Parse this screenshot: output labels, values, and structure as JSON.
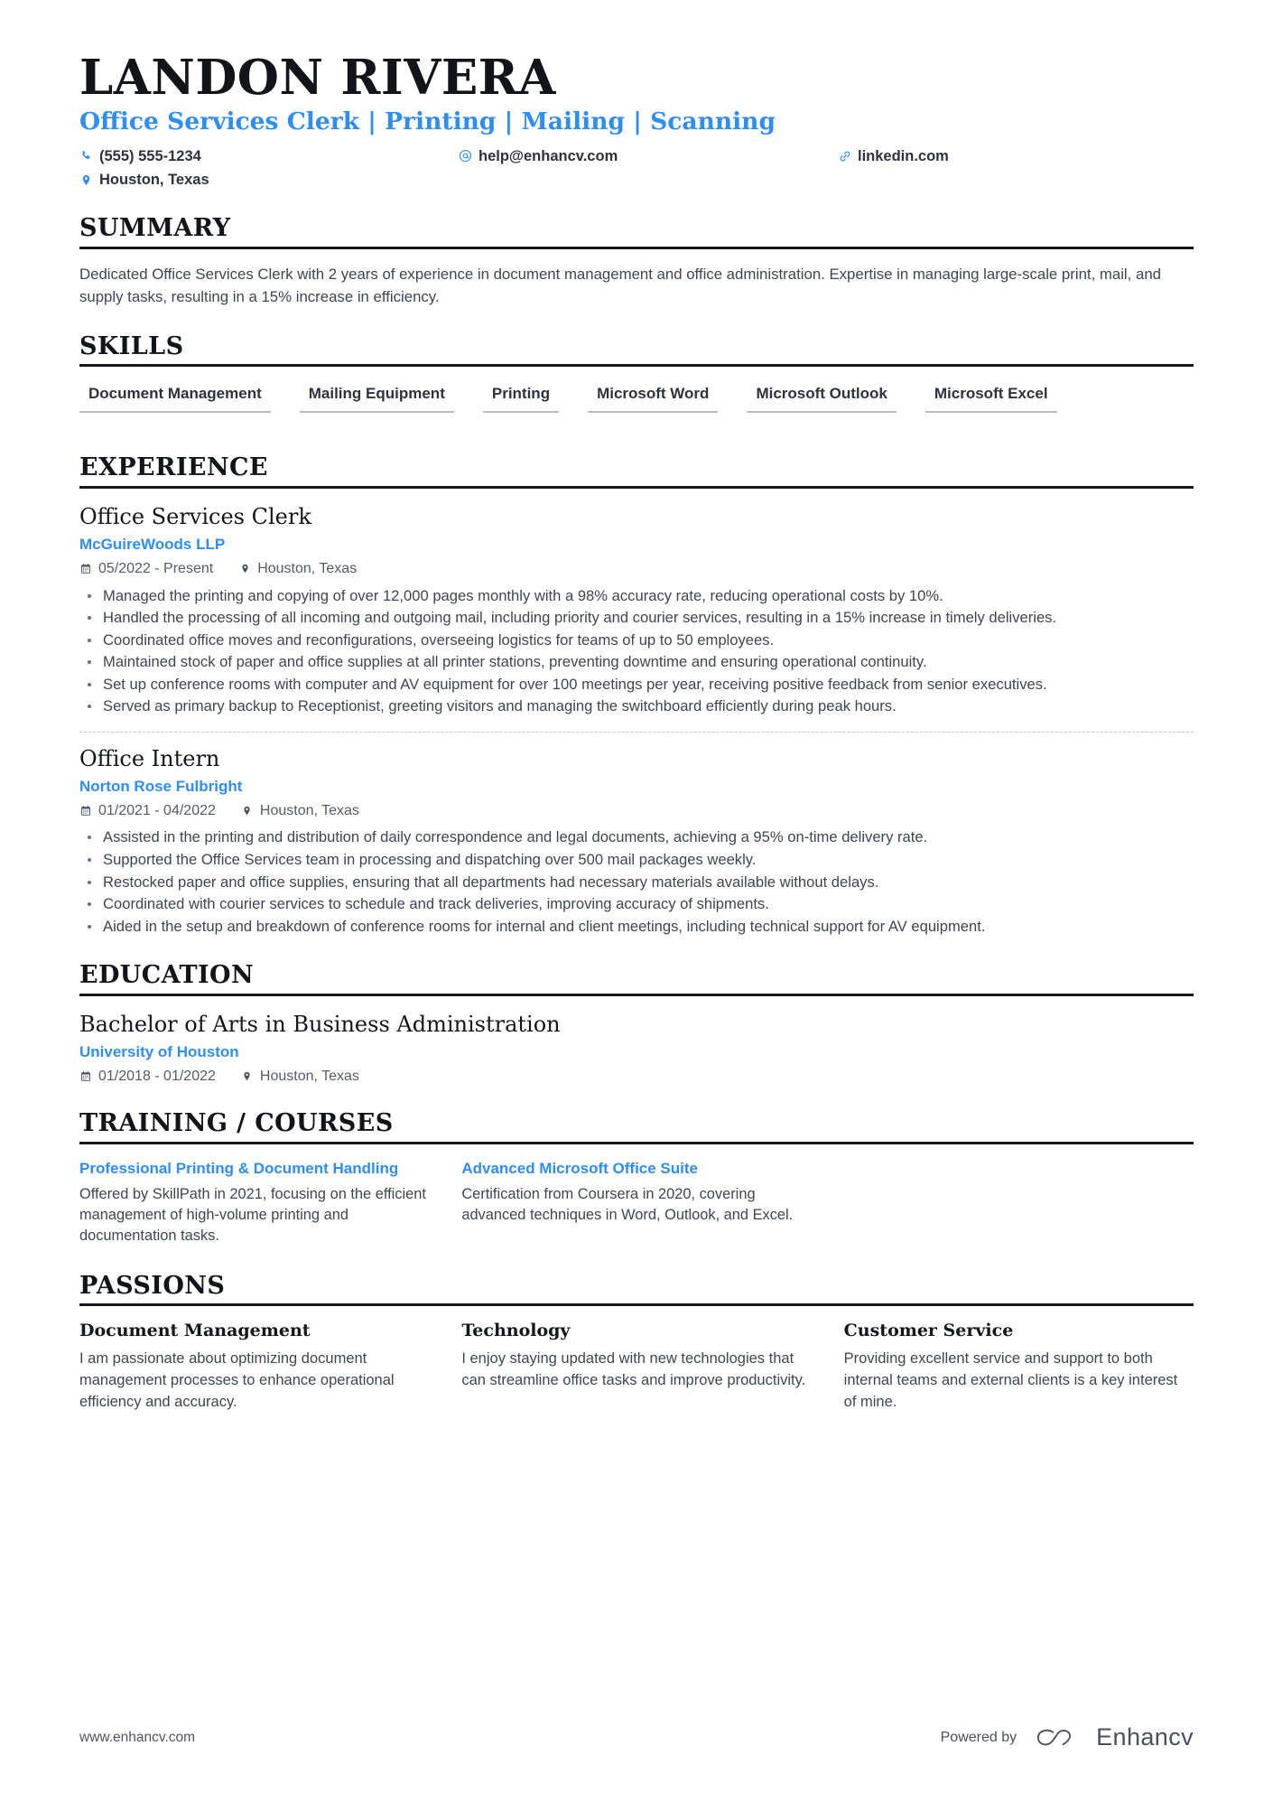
{
  "header": {
    "name": "LANDON RIVERA",
    "headline": "Office Services Clerk | Printing | Mailing | Scanning",
    "contacts": [
      {
        "icon": "phone-icon",
        "value": "(555) 555-1234"
      },
      {
        "icon": "email-icon",
        "value": "help@enhancv.com"
      },
      {
        "icon": "link-icon",
        "value": "linkedin.com"
      },
      {
        "icon": "location-icon",
        "value": "Houston, Texas"
      }
    ]
  },
  "colors": {
    "accent": "#2f8ef4",
    "heading": "#13171c",
    "body": "#3f4652",
    "rule": "#14181d",
    "chip_underline": "#b9bcc2"
  },
  "sections": {
    "summary": {
      "title": "SUMMARY",
      "text": "Dedicated Office Services Clerk with 2 years of experience in document management and office administration. Expertise in managing large-scale print, mail, and supply tasks, resulting in a 15% increase in efficiency."
    },
    "skills": {
      "title": "SKILLS",
      "items": [
        "Document Management",
        "Mailing Equipment",
        "Printing",
        "Microsoft Word",
        "Microsoft Outlook",
        "Microsoft Excel"
      ]
    },
    "experience": {
      "title": "EXPERIENCE",
      "entries": [
        {
          "role": "Office Services Clerk",
          "company": "McGuireWoods LLP",
          "dates": "05/2022 - Present",
          "location": "Houston, Texas",
          "bullets": [
            "Managed the printing and copying of over 12,000 pages monthly with a 98% accuracy rate, reducing operational costs by 10%.",
            "Handled the processing of all incoming and outgoing mail, including priority and courier services, resulting in a 15% increase in timely deliveries.",
            "Coordinated office moves and reconfigurations, overseeing logistics for teams of up to 50 employees.",
            "Maintained stock of paper and office supplies at all printer stations, preventing downtime and ensuring operational continuity.",
            "Set up conference rooms with computer and AV equipment for over 100 meetings per year, receiving positive feedback from senior executives.",
            "Served as primary backup to Receptionist, greeting visitors and managing the switchboard efficiently during peak hours."
          ]
        },
        {
          "role": "Office Intern",
          "company": "Norton Rose Fulbright",
          "dates": "01/2021 - 04/2022",
          "location": "Houston, Texas",
          "bullets": [
            "Assisted in the printing and distribution of daily correspondence and legal documents, achieving a 95% on-time delivery rate.",
            "Supported the Office Services team in processing and dispatching over 500 mail packages weekly.",
            "Restocked paper and office supplies, ensuring that all departments had necessary materials available without delays.",
            "Coordinated with courier services to schedule and track deliveries, improving accuracy of shipments.",
            "Aided in the setup and breakdown of conference rooms for internal and client meetings, including technical support for AV equipment."
          ]
        }
      ]
    },
    "education": {
      "title": "EDUCATION",
      "entries": [
        {
          "degree": "Bachelor of Arts in Business Administration",
          "school": "University of Houston",
          "dates": "01/2018 - 01/2022",
          "location": "Houston, Texas"
        }
      ]
    },
    "training": {
      "title": "TRAINING / COURSES",
      "courses": [
        {
          "title": "Professional Printing & Document Handling",
          "description": "Offered by SkillPath in 2021, focusing on the efficient management of high-volume printing and documentation tasks."
        },
        {
          "title": "Advanced Microsoft Office Suite",
          "description": "Certification from Coursera in 2020, covering advanced techniques in Word, Outlook, and Excel."
        }
      ]
    },
    "passions": {
      "title": "PASSIONS",
      "items": [
        {
          "title": "Document Management",
          "description": "I am passionate about optimizing document management processes to enhance operational efficiency and accuracy."
        },
        {
          "title": "Technology",
          "description": "I enjoy staying updated with new technologies that can streamline office tasks and improve productivity."
        },
        {
          "title": "Customer Service",
          "description": "Providing excellent service and support to both internal teams and external clients is a key interest of mine."
        }
      ]
    }
  },
  "footer": {
    "url": "www.enhancv.com",
    "powered_by": "Powered by",
    "brand": "Enhancv"
  }
}
